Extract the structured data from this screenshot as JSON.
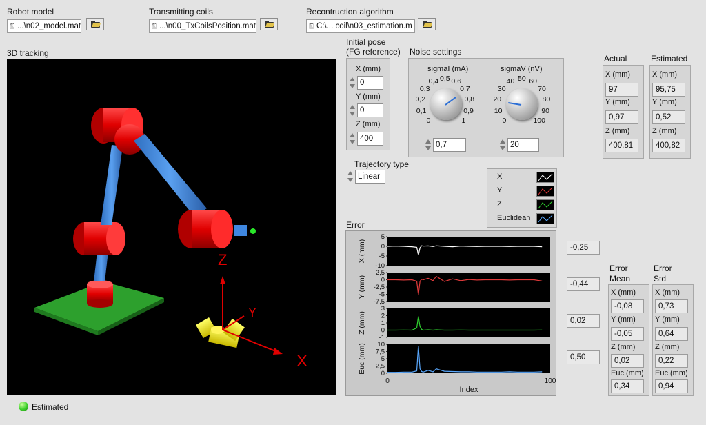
{
  "files": {
    "robot_model": {
      "label": "Robot model",
      "value": "...\\n02_model.mat"
    },
    "tx_coils": {
      "label": "Transmitting coils",
      "value": "...\\n00_TxCoilsPosition.mat"
    },
    "reconstruction": {
      "label": "Recontruction algorithm",
      "value": "C:\\... coil\\n03_estimation.m"
    }
  },
  "tracking": {
    "label": "3D tracking",
    "axis_z": "Z",
    "axis_y": "Y",
    "axis_x": "X"
  },
  "initial_pose": {
    "title_line1": "Initial pose",
    "title_line2": "(FG reference)",
    "x_label": "X (mm)",
    "x_value": "0",
    "y_label": "Y (mm)",
    "y_value": "0",
    "z_label": "Z (mm)",
    "z_value": "400"
  },
  "noise": {
    "title": "Noise settings",
    "sigma_ma": {
      "label": "sigmaI (mA)",
      "value": "0,7",
      "level_fraction": 0.7,
      "ticks": [
        "0",
        "0,1",
        "0,2",
        "0,3",
        "0,4",
        "0,5",
        "0,6",
        "0,7",
        "0,8",
        "0,9",
        "1"
      ]
    },
    "sigma_v": {
      "label": "sigmaV (nV)",
      "value": "20",
      "level_fraction": 0.2,
      "ticks": [
        "0",
        "10",
        "20",
        "30",
        "40",
        "50",
        "60",
        "70",
        "80",
        "90",
        "100"
      ]
    }
  },
  "trajectory": {
    "label": "Trajectory type",
    "value": "Linear"
  },
  "actual": {
    "title": "Actual",
    "x_label": "X (mm)",
    "x": "97",
    "y_label": "Y (mm)",
    "y": "0,97",
    "z_label": "Z (mm)",
    "z": "400,81"
  },
  "estimated": {
    "title": "Estimated",
    "x_label": "X (mm)",
    "x": "95,75",
    "y_label": "Y (mm)",
    "y": "0,52",
    "z_label": "Z (mm)",
    "z": "400,82"
  },
  "legend": [
    {
      "name": "X",
      "color": "#ffffff"
    },
    {
      "name": "Y",
      "color": "#e23b3b"
    },
    {
      "name": "Z",
      "color": "#2fd12f"
    },
    {
      "name": "Euclidean",
      "color": "#5aa9ff"
    }
  ],
  "error_graph": {
    "title": "Error",
    "xlabel": "Index",
    "x_ticks": [
      "0",
      "100"
    ],
    "panels": [
      {
        "ylabel": "X (mm)",
        "ticks": [
          "5",
          "0",
          "-5",
          "-10"
        ],
        "current": "-0,25"
      },
      {
        "ylabel": "Y (mm)",
        "ticks": [
          "2,5",
          "0",
          "-2,5",
          "-5",
          "-7,5"
        ],
        "current": "-0,44"
      },
      {
        "ylabel": "Z (mm)",
        "ticks": [
          "3",
          "2",
          "1",
          "0",
          "-1"
        ],
        "current": "0,02"
      },
      {
        "ylabel": "Euc (mm)",
        "ticks": [
          "10",
          "7,5",
          "5",
          "2,5",
          "0"
        ],
        "current": "0,50"
      }
    ]
  },
  "chart_data": {
    "type": "line",
    "x": [
      0,
      5,
      10,
      15,
      18,
      19,
      20,
      21,
      22,
      25,
      28,
      30,
      35,
      40,
      45,
      50,
      55,
      60,
      65,
      70,
      75,
      80,
      85,
      90,
      95
    ],
    "series": [
      {
        "name": "X",
        "values": [
          0,
          0.1,
          0,
          -0.2,
          -0.5,
          -4.5,
          -0.8,
          0.3,
          0.1,
          0.2,
          -0.1,
          0.3,
          0,
          -0.2,
          0.1,
          0,
          -0.1,
          0,
          0,
          0,
          -0.1,
          0,
          0,
          0,
          -0.25
        ]
      },
      {
        "name": "Y",
        "values": [
          0,
          0,
          -0.1,
          0,
          -0.5,
          -5.2,
          -0.5,
          0.2,
          0,
          0.5,
          -0.3,
          1.2,
          -0.6,
          0.3,
          -0.3,
          0.1,
          -0.1,
          0,
          0,
          0,
          -0.1,
          0,
          0,
          0,
          -0.44
        ]
      },
      {
        "name": "Z",
        "values": [
          0,
          0,
          0.02,
          0,
          0.3,
          1.9,
          0.5,
          0.1,
          0,
          0.05,
          0,
          0.05,
          0,
          0,
          0.02,
          0,
          0,
          0,
          0,
          0,
          0,
          0,
          0,
          0,
          0.02
        ]
      },
      {
        "name": "Euclidean",
        "values": [
          0.3,
          0.3,
          0.4,
          0.4,
          0.8,
          9.5,
          1.5,
          0.6,
          0.4,
          1.0,
          0.5,
          1.5,
          0.7,
          0.6,
          0.5,
          0.5,
          0.4,
          0.4,
          0.4,
          0.4,
          0.5,
          0.4,
          0.4,
          0.4,
          0.5
        ]
      }
    ],
    "ylims": [
      [
        -10,
        5
      ],
      [
        -7.5,
        2.5
      ],
      [
        -1,
        3
      ],
      [
        0,
        10
      ]
    ],
    "xlim": [
      0,
      100
    ]
  },
  "error_mean": {
    "title_line1": "Error",
    "title_line2": "Mean",
    "rows": [
      {
        "label": "X (mm)",
        "value": "-0,08"
      },
      {
        "label": "Y (mm)",
        "value": "-0,05"
      },
      {
        "label": "Z (mm)",
        "value": "0,02"
      },
      {
        "label": "Euc (mm)",
        "value": "0,34"
      }
    ]
  },
  "error_std": {
    "title_line1": "Error",
    "title_line2": "Std",
    "rows": [
      {
        "label": "X (mm)",
        "value": "0,73"
      },
      {
        "label": "Y (mm)",
        "value": "0,64"
      },
      {
        "label": "Z (mm)",
        "value": "0,22"
      },
      {
        "label": "Euc (mm)",
        "value": "0,94"
      }
    ]
  },
  "status": {
    "label": "Estimated",
    "led_color": "#3ccf2a"
  }
}
